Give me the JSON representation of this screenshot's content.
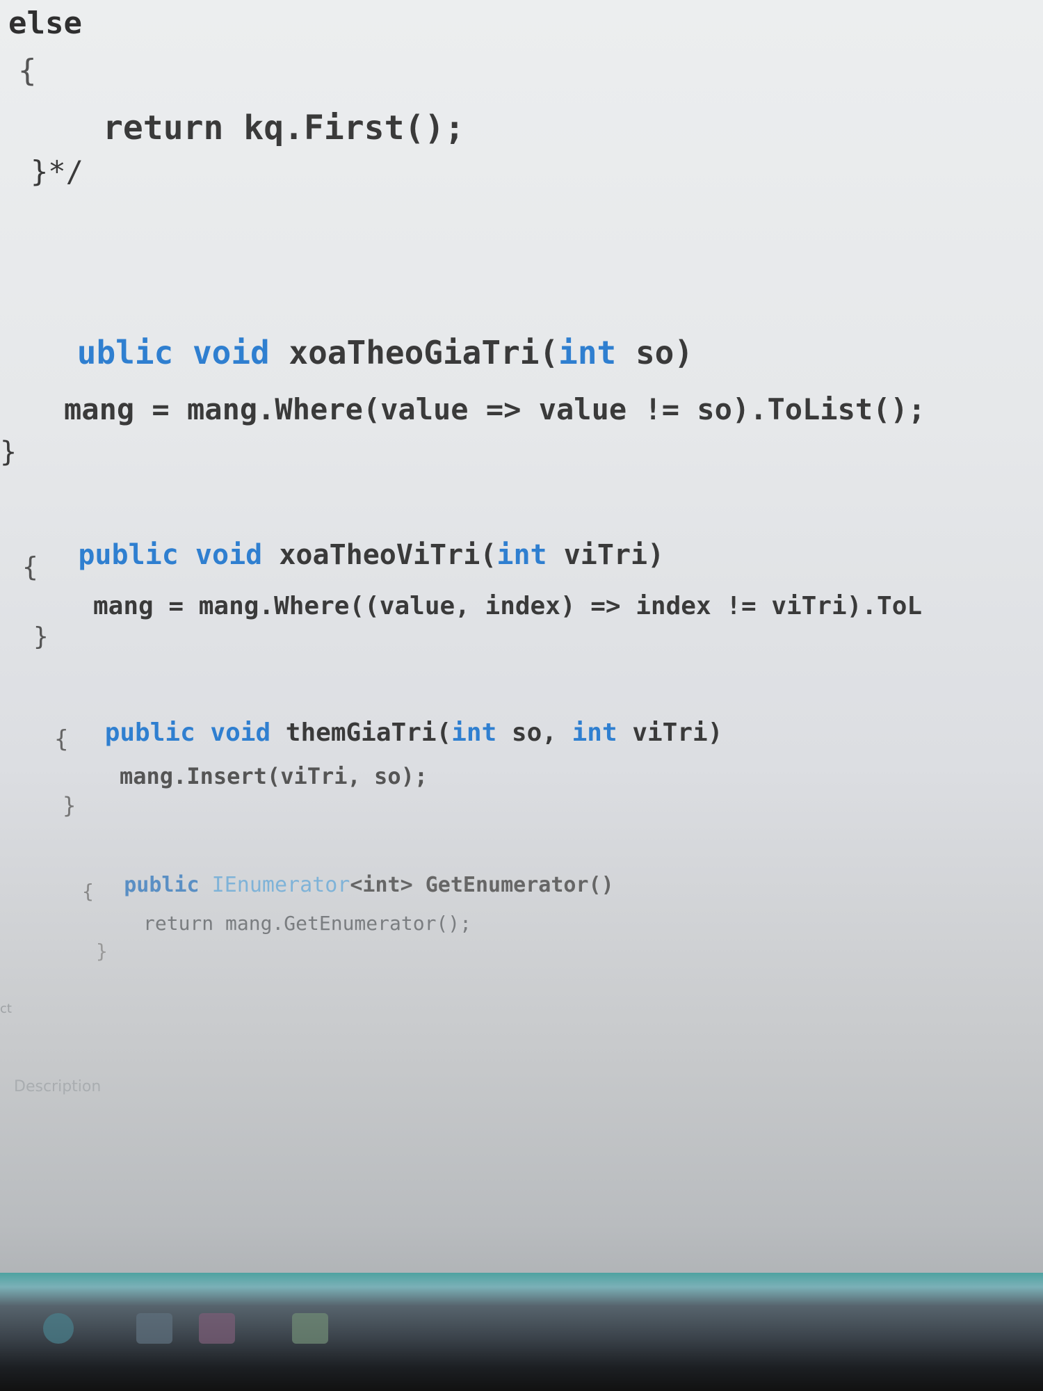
{
  "editor": {
    "lines": {
      "l1": "else",
      "l2": "{",
      "l3": "return kq.First();",
      "l4": "}*/",
      "l5_kw": "ublic void",
      "l5_rest": " xoaTheoGiaTri(",
      "l5_int": "int",
      "l5_end": " so)",
      "l6": "mang = mang.Where(value => value != so).ToList();",
      "l7": "}",
      "l8_kw": "public void",
      "l8_rest": " xoaTheoViTri(",
      "l8_int": "int",
      "l8_end": " viTri)",
      "l9": "{",
      "l10": "mang = mang.Where((value, index) => index != viTri).ToL",
      "l11": "}",
      "l12_kw": "public void",
      "l12_rest": " themGiaTri(",
      "l12_int1": "int",
      "l12_mid": " so, ",
      "l12_int2": "int",
      "l12_end": " viTri)",
      "l13": "{",
      "l14": "mang.Insert(viTri, so);",
      "l15": "}",
      "l16_kw": "public",
      "l16_type": " IEnumerator",
      "l16_rest": "<int> GetEnumerator()",
      "l17": "{",
      "l18": "return mang.GetEnumerator();",
      "l19": "}"
    }
  },
  "panel": {
    "description_label": "Description",
    "edge_mark": "ct"
  },
  "colors": {
    "keyword": "#2f7fd0",
    "text": "#3a3a3a",
    "type": "#7fb3d8",
    "taskbar_accent": "#4ea2a0"
  },
  "taskbar": {
    "icons": [
      "chrome-icon",
      "file-explorer-icon",
      "app-icon",
      "folder-icon"
    ]
  }
}
